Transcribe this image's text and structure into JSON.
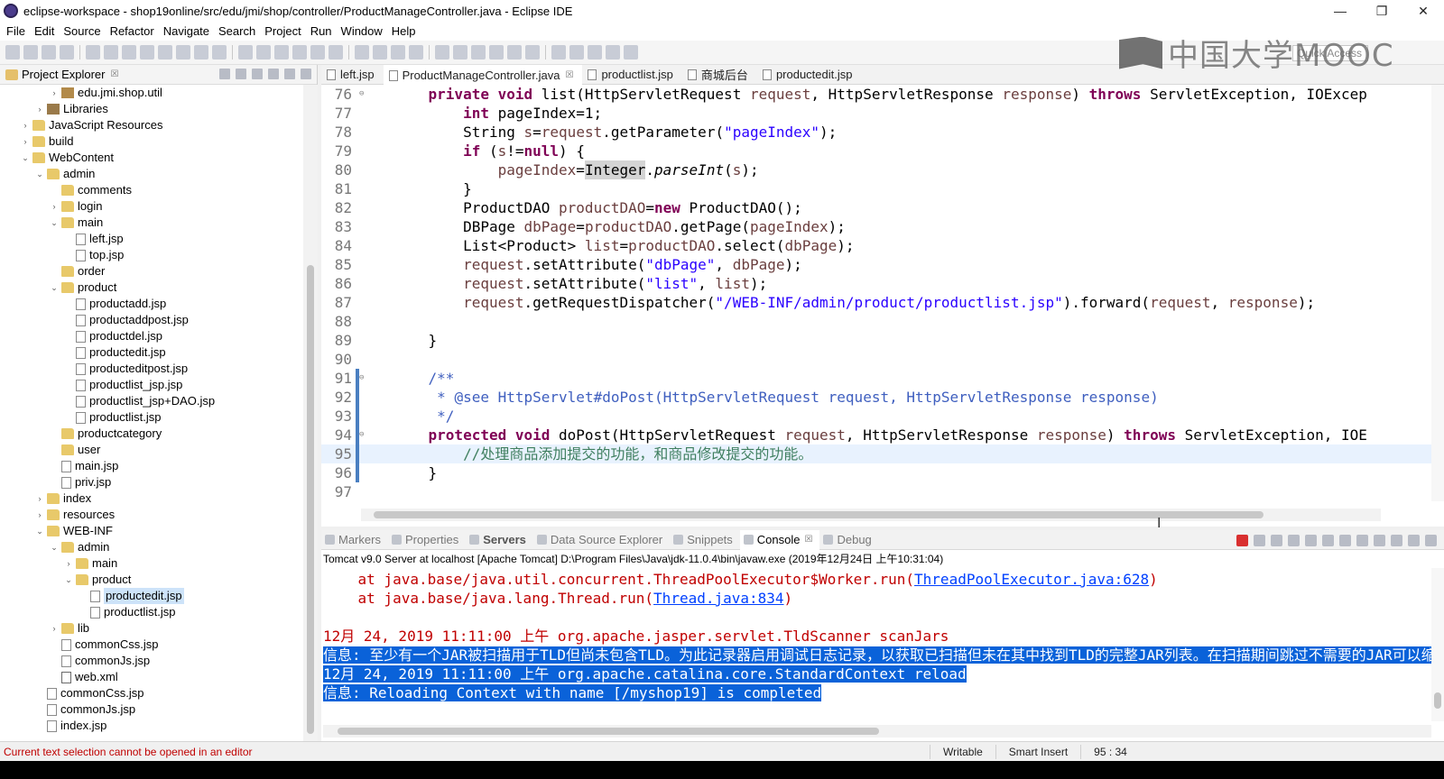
{
  "window": {
    "title": "eclipse-workspace - shop19online/src/edu/jmi/shop/controller/ProductManageController.java - Eclipse IDE",
    "minimize": "—",
    "maximize": "❐",
    "close": "✕"
  },
  "menu": [
    "File",
    "Edit",
    "Source",
    "Refactor",
    "Navigate",
    "Search",
    "Project",
    "Run",
    "Window",
    "Help"
  ],
  "watermark": "中国大学MOOC",
  "quick_access": "Quick Access",
  "explorer": {
    "tab_label": "Project Explorer",
    "tab_close": "☒",
    "items": [
      {
        "label": "edu.jmi.shop.util",
        "indent": 3,
        "icon": "pkg",
        "twisty": "›"
      },
      {
        "label": "Libraries",
        "indent": 2,
        "icon": "lib",
        "twisty": "›"
      },
      {
        "label": "JavaScript Resources",
        "indent": 1,
        "icon": "folder",
        "twisty": "›"
      },
      {
        "label": "build",
        "indent": 1,
        "icon": "folder",
        "twisty": "›"
      },
      {
        "label": "WebContent",
        "indent": 1,
        "icon": "folder",
        "twisty": "⌄"
      },
      {
        "label": "admin",
        "indent": 2,
        "icon": "folder",
        "twisty": "⌄"
      },
      {
        "label": "comments",
        "indent": 3,
        "icon": "folder",
        "twisty": ""
      },
      {
        "label": "login",
        "indent": 3,
        "icon": "folder",
        "twisty": "›"
      },
      {
        "label": "main",
        "indent": 3,
        "icon": "folder",
        "twisty": "⌄"
      },
      {
        "label": "left.jsp",
        "indent": 4,
        "icon": "file",
        "twisty": ""
      },
      {
        "label": "top.jsp",
        "indent": 4,
        "icon": "file",
        "twisty": ""
      },
      {
        "label": "order",
        "indent": 3,
        "icon": "folder",
        "twisty": ""
      },
      {
        "label": "product",
        "indent": 3,
        "icon": "folder",
        "twisty": "⌄"
      },
      {
        "label": "productadd.jsp",
        "indent": 4,
        "icon": "file",
        "twisty": ""
      },
      {
        "label": "productaddpost.jsp",
        "indent": 4,
        "icon": "file",
        "twisty": ""
      },
      {
        "label": "productdel.jsp",
        "indent": 4,
        "icon": "file",
        "twisty": ""
      },
      {
        "label": "productedit.jsp",
        "indent": 4,
        "icon": "file",
        "twisty": ""
      },
      {
        "label": "producteditpost.jsp",
        "indent": 4,
        "icon": "file",
        "twisty": ""
      },
      {
        "label": "productlist_jsp.jsp",
        "indent": 4,
        "icon": "file",
        "twisty": ""
      },
      {
        "label": "productlist_jsp+DAO.jsp",
        "indent": 4,
        "icon": "file",
        "twisty": ""
      },
      {
        "label": "productlist.jsp",
        "indent": 4,
        "icon": "file",
        "twisty": ""
      },
      {
        "label": "productcategory",
        "indent": 3,
        "icon": "folder",
        "twisty": ""
      },
      {
        "label": "user",
        "indent": 3,
        "icon": "folder",
        "twisty": ""
      },
      {
        "label": "main.jsp",
        "indent": 3,
        "icon": "file",
        "twisty": ""
      },
      {
        "label": "priv.jsp",
        "indent": 3,
        "icon": "file",
        "twisty": ""
      },
      {
        "label": "index",
        "indent": 2,
        "icon": "folder",
        "twisty": "›"
      },
      {
        "label": "resources",
        "indent": 2,
        "icon": "folder",
        "twisty": "›"
      },
      {
        "label": "WEB-INF",
        "indent": 2,
        "icon": "folder",
        "twisty": "⌄"
      },
      {
        "label": "admin",
        "indent": 3,
        "icon": "folder",
        "twisty": "⌄"
      },
      {
        "label": "main",
        "indent": 4,
        "icon": "folder",
        "twisty": "›"
      },
      {
        "label": "product",
        "indent": 4,
        "icon": "folder",
        "twisty": "⌄"
      },
      {
        "label": "productedit.jsp",
        "indent": 5,
        "icon": "file",
        "twisty": "",
        "selected": true
      },
      {
        "label": "productlist.jsp",
        "indent": 5,
        "icon": "file",
        "twisty": ""
      },
      {
        "label": "lib",
        "indent": 3,
        "icon": "folder",
        "twisty": "›"
      },
      {
        "label": "commonCss.jsp",
        "indent": 3,
        "icon": "file",
        "twisty": ""
      },
      {
        "label": "commonJs.jsp",
        "indent": 3,
        "icon": "file",
        "twisty": ""
      },
      {
        "label": "web.xml",
        "indent": 3,
        "icon": "xml",
        "twisty": ""
      },
      {
        "label": "commonCss.jsp",
        "indent": 2,
        "icon": "file",
        "twisty": ""
      },
      {
        "label": "commonJs.jsp",
        "indent": 2,
        "icon": "file",
        "twisty": ""
      },
      {
        "label": "index.jsp",
        "indent": 2,
        "icon": "file",
        "twisty": ""
      }
    ]
  },
  "editor": {
    "tabs": [
      {
        "label": "left.jsp",
        "active": false,
        "close": ""
      },
      {
        "label": "ProductManageController.java",
        "active": true,
        "close": "☒"
      },
      {
        "label": "productlist.jsp",
        "active": false,
        "close": ""
      },
      {
        "label": "商城后台",
        "active": false,
        "close": ""
      },
      {
        "label": "productedit.jsp",
        "active": false,
        "close": ""
      }
    ],
    "cursor_glyph": "I",
    "lines": [
      {
        "n": "76",
        "fold": "⊖",
        "mark": false,
        "segs": [
          [
            "    ",
            ""
          ],
          [
            "private void ",
            "kw"
          ],
          [
            "list(HttpServletRequest ",
            ""
          ],
          [
            "request",
            "var"
          ],
          [
            ", HttpServletResponse ",
            ""
          ],
          [
            "response",
            "var"
          ],
          [
            ") ",
            ""
          ],
          [
            "throws ",
            "kw"
          ],
          [
            "ServletException, IOExcep",
            ""
          ]
        ]
      },
      {
        "n": "77",
        "fold": "",
        "mark": false,
        "segs": [
          [
            "        ",
            ""
          ],
          [
            "int ",
            "kw"
          ],
          [
            "pageIndex=1;",
            ""
          ]
        ]
      },
      {
        "n": "78",
        "fold": "",
        "mark": false,
        "segs": [
          [
            "        String ",
            ""
          ],
          [
            "s",
            "var"
          ],
          [
            "=",
            ""
          ],
          [
            "request",
            "var"
          ],
          [
            ".getParameter(",
            ""
          ],
          [
            "\"pageIndex\"",
            "str"
          ],
          [
            ");",
            ""
          ]
        ]
      },
      {
        "n": "79",
        "fold": "",
        "mark": false,
        "segs": [
          [
            "        ",
            ""
          ],
          [
            "if ",
            "kw"
          ],
          [
            "(",
            ""
          ],
          [
            "s",
            "var"
          ],
          [
            "!=",
            ""
          ],
          [
            "null",
            "kw"
          ],
          [
            ") {",
            ""
          ]
        ]
      },
      {
        "n": "80",
        "fold": "",
        "mark": false,
        "segs": [
          [
            "            ",
            ""
          ],
          [
            "pageIndex",
            "var"
          ],
          [
            "=",
            ""
          ],
          [
            "Integer",
            "hl"
          ],
          [
            ".",
            ""
          ],
          [
            "parseInt",
            "it"
          ],
          [
            "(",
            ""
          ],
          [
            "s",
            "var"
          ],
          [
            ");",
            ""
          ]
        ]
      },
      {
        "n": "81",
        "fold": "",
        "mark": false,
        "segs": [
          [
            "        }",
            ""
          ]
        ]
      },
      {
        "n": "82",
        "fold": "",
        "mark": false,
        "segs": [
          [
            "        ProductDAO ",
            ""
          ],
          [
            "productDAO",
            "var"
          ],
          [
            "=",
            ""
          ],
          [
            "new ",
            "kw"
          ],
          [
            "ProductDAO();",
            ""
          ]
        ]
      },
      {
        "n": "83",
        "fold": "",
        "mark": false,
        "segs": [
          [
            "        DBPage ",
            ""
          ],
          [
            "dbPage",
            "var"
          ],
          [
            "=",
            ""
          ],
          [
            "productDAO",
            "var"
          ],
          [
            ".getPage(",
            ""
          ],
          [
            "pageIndex",
            "var"
          ],
          [
            ");",
            ""
          ]
        ]
      },
      {
        "n": "84",
        "fold": "",
        "mark": false,
        "segs": [
          [
            "        List<Product> ",
            ""
          ],
          [
            "list",
            "var"
          ],
          [
            "=",
            ""
          ],
          [
            "productDAO",
            "var"
          ],
          [
            ".select(",
            ""
          ],
          [
            "dbPage",
            "var"
          ],
          [
            ");",
            ""
          ]
        ]
      },
      {
        "n": "85",
        "fold": "",
        "mark": false,
        "segs": [
          [
            "        ",
            ""
          ],
          [
            "request",
            "var"
          ],
          [
            ".setAttribute(",
            ""
          ],
          [
            "\"dbPage\"",
            "str"
          ],
          [
            ", ",
            ""
          ],
          [
            "dbPage",
            "var"
          ],
          [
            ");",
            ""
          ]
        ]
      },
      {
        "n": "86",
        "fold": "",
        "mark": false,
        "segs": [
          [
            "        ",
            ""
          ],
          [
            "request",
            "var"
          ],
          [
            ".setAttribute(",
            ""
          ],
          [
            "\"list\"",
            "str"
          ],
          [
            ", ",
            ""
          ],
          [
            "list",
            "var"
          ],
          [
            ");",
            ""
          ]
        ]
      },
      {
        "n": "87",
        "fold": "",
        "mark": false,
        "segs": [
          [
            "        ",
            ""
          ],
          [
            "request",
            "var"
          ],
          [
            ".getRequestDispatcher(",
            ""
          ],
          [
            "\"/WEB-INF/admin/product/productlist.jsp\"",
            "str"
          ],
          [
            ").forward(",
            ""
          ],
          [
            "request",
            "var"
          ],
          [
            ", ",
            ""
          ],
          [
            "response",
            "var"
          ],
          [
            ");",
            ""
          ]
        ]
      },
      {
        "n": "88",
        "fold": "",
        "mark": false,
        "segs": [
          [
            "",
            ""
          ]
        ]
      },
      {
        "n": "89",
        "fold": "",
        "mark": false,
        "segs": [
          [
            "    }",
            ""
          ]
        ]
      },
      {
        "n": "90",
        "fold": "",
        "mark": false,
        "segs": [
          [
            "",
            ""
          ]
        ]
      },
      {
        "n": "91",
        "fold": "⊖",
        "mark": true,
        "segs": [
          [
            "    /**",
            "jd"
          ]
        ]
      },
      {
        "n": "92",
        "fold": "",
        "mark": true,
        "segs": [
          [
            "     * ",
            "jd"
          ],
          [
            "@see ",
            "jd"
          ],
          [
            "HttpServlet#doPost(HttpServletRequest request, HttpServletResponse response)",
            "jd"
          ]
        ]
      },
      {
        "n": "93",
        "fold": "",
        "mark": true,
        "segs": [
          [
            "     */",
            "jd"
          ]
        ]
      },
      {
        "n": "94",
        "fold": "⊖",
        "mark": true,
        "segs": [
          [
            "    ",
            ""
          ],
          [
            "protected void ",
            "kw"
          ],
          [
            "doPost(HttpServletRequest ",
            ""
          ],
          [
            "request",
            "var"
          ],
          [
            ", HttpServletResponse ",
            ""
          ],
          [
            "response",
            "var"
          ],
          [
            ") ",
            ""
          ],
          [
            "throws ",
            "kw"
          ],
          [
            "ServletException, IOE",
            ""
          ]
        ]
      },
      {
        "n": "95",
        "fold": "",
        "mark": true,
        "current": true,
        "segs": [
          [
            "        //处理商品添加提交的功能，和商品修改提交的功能。",
            "cm"
          ]
        ]
      },
      {
        "n": "96",
        "fold": "",
        "mark": true,
        "segs": [
          [
            "    }",
            ""
          ]
        ]
      },
      {
        "n": "97",
        "fold": "",
        "mark": false,
        "segs": [
          [
            "",
            ""
          ]
        ]
      }
    ]
  },
  "console": {
    "tabs": [
      {
        "label": "Markers",
        "active": false,
        "bold": false
      },
      {
        "label": "Properties",
        "active": false,
        "bold": false
      },
      {
        "label": "Servers",
        "active": false,
        "bold": true
      },
      {
        "label": "Data Source Explorer",
        "active": false,
        "bold": false
      },
      {
        "label": "Snippets",
        "active": false,
        "bold": false
      },
      {
        "label": "Console",
        "active": true,
        "bold": false,
        "close": "☒"
      },
      {
        "label": "Debug",
        "active": false,
        "bold": false
      }
    ],
    "description": "Tomcat v9.0 Server at localhost [Apache Tomcat] D:\\Program Files\\Java\\jdk-11.0.4\\bin\\javaw.exe (2019年12月24日 上午10:31:04)",
    "lines": [
      {
        "pre": "    at java.base/java.util.concurrent.ThreadPoolExecutor$Worker.run(",
        "link": "ThreadPoolExecutor.java:628",
        "post": ")",
        "sel": false
      },
      {
        "pre": "    at java.base/java.lang.Thread.run(",
        "link": "Thread.java:834",
        "post": ")",
        "sel": false
      },
      {
        "pre": "",
        "link": "",
        "post": "",
        "sel": false
      },
      {
        "pre": "12月 24, 2019 11:11:00 上午 org.apache.jasper.servlet.TldScanner scanJars",
        "link": "",
        "post": "",
        "sel": false
      },
      {
        "pre": "信息: 至少有一个JAR被扫描用于TLD但尚未包含TLD。为此记录器启用调试日志记录，以获取已扫描但未在其中找到TLD的完整JAR列表。在扫描期间跳过不需要的JAR可以缩短",
        "link": "",
        "post": "",
        "sel": true
      },
      {
        "pre": "12月 24, 2019 11:11:00 上午 org.apache.catalina.core.StandardContext reload",
        "link": "",
        "post": "",
        "sel": true
      },
      {
        "pre": "信息: Reloading Context with name [/myshop19] is completed",
        "link": "",
        "post": "",
        "sel": true
      }
    ]
  },
  "status": {
    "message": "Current text selection cannot be opened in an editor",
    "mode": "Writable",
    "insert": "Smart Insert",
    "position": "95 : 34"
  }
}
